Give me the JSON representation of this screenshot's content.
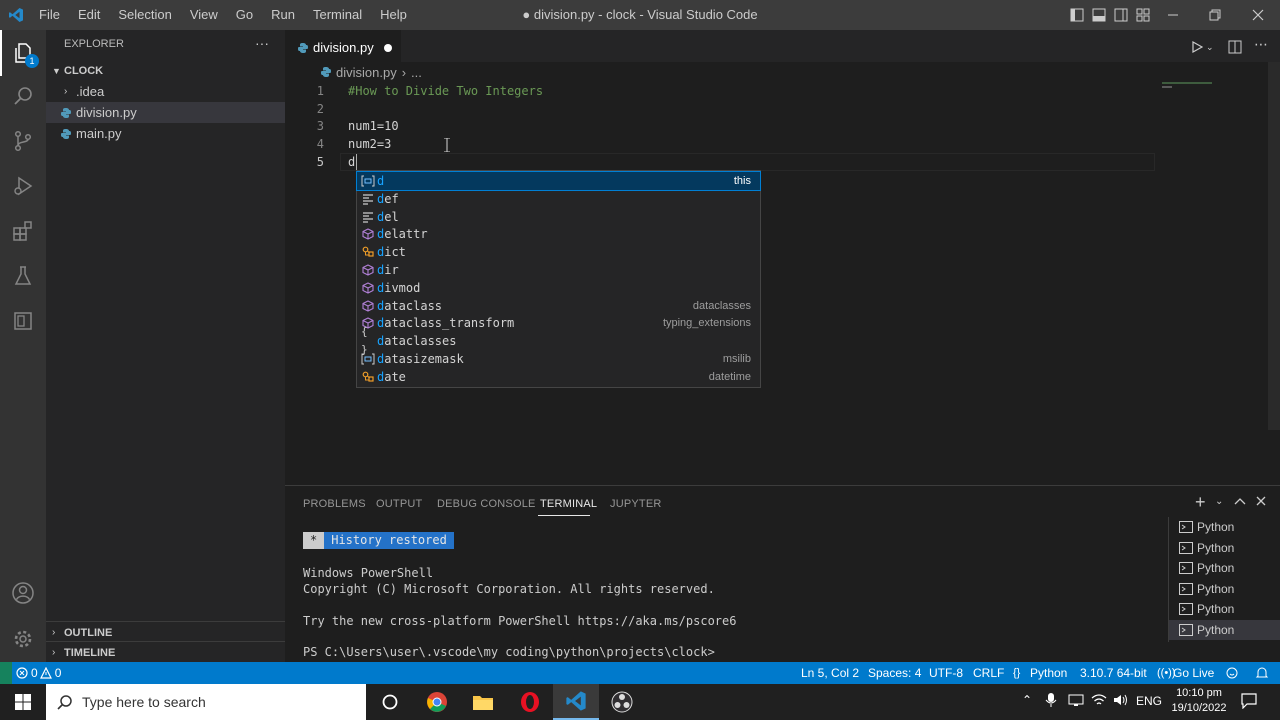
{
  "titlebar": {
    "menu": [
      "File",
      "Edit",
      "Selection",
      "View",
      "Go",
      "Run",
      "Terminal",
      "Help"
    ],
    "window_title": "● division.py - clock - Visual Studio Code"
  },
  "activity": {
    "explorer_badge": "1"
  },
  "sidebar": {
    "header": "EXPLORER",
    "more": "···",
    "folder": "CLOCK",
    "items": [
      ".idea",
      "division.py",
      "main.py"
    ],
    "outline": "OUTLINE",
    "timeline": "TIMELINE"
  },
  "editor": {
    "tab_label": "division.py",
    "breadcrumb_file": "division.py",
    "breadcrumb_more": "...",
    "lines": [
      {
        "n": "1",
        "text": "#How to Divide Two Integers"
      },
      {
        "n": "2",
        "text": ""
      },
      {
        "n": "3",
        "text": "num1=10"
      },
      {
        "n": "4",
        "text": "num2=3"
      },
      {
        "n": "5",
        "text": "d"
      }
    ],
    "suggestions": [
      {
        "match": "d",
        "rest": "",
        "detail": "this",
        "icon": "variable-icon"
      },
      {
        "match": "d",
        "rest": "ef",
        "detail": "",
        "icon": "keyword-icon"
      },
      {
        "match": "d",
        "rest": "el",
        "detail": "",
        "icon": "keyword-icon"
      },
      {
        "match": "d",
        "rest": "elattr",
        "detail": "",
        "icon": "function-icon"
      },
      {
        "match": "d",
        "rest": "ict",
        "detail": "",
        "icon": "class-icon"
      },
      {
        "match": "d",
        "rest": "ir",
        "detail": "",
        "icon": "function-icon"
      },
      {
        "match": "d",
        "rest": "ivmod",
        "detail": "",
        "icon": "function-icon"
      },
      {
        "match": "d",
        "rest": "ataclass",
        "detail": "dataclasses",
        "icon": "function-icon"
      },
      {
        "match": "d",
        "rest": "ataclass_transform",
        "detail": "typing_extensions",
        "icon": "function-icon"
      },
      {
        "match": "d",
        "rest": "ataclasses",
        "detail": "",
        "icon": "module-icon"
      },
      {
        "match": "d",
        "rest": "atasizemask",
        "detail": "msilib",
        "icon": "variable-icon"
      },
      {
        "match": "d",
        "rest": "ate",
        "detail": "datetime",
        "icon": "class-icon"
      }
    ]
  },
  "panel": {
    "tabs": [
      "PROBLEMS",
      "OUTPUT",
      "DEBUG CONSOLE",
      "TERMINAL",
      "JUPYTER"
    ],
    "active_tab": "TERMINAL",
    "history_star": "*",
    "history": "History restored",
    "terminal_lines": [
      "Windows PowerShell",
      "Copyright (C) Microsoft Corporation. All rights reserved.",
      "",
      "Try the new cross-platform PowerShell https://aka.ms/pscore6",
      "",
      "PS C:\\Users\\user\\.vscode\\my coding\\python\\projects\\clock>"
    ],
    "terminals": [
      "Python",
      "Python",
      "Python",
      "Python",
      "Python",
      "Python"
    ]
  },
  "status": {
    "errors": "0",
    "warnings": "0",
    "position": "Ln 5, Col 2",
    "spaces": "Spaces: 4",
    "encoding": "UTF-8",
    "eol": "CRLF",
    "language": "Python",
    "interpreter": "3.10.7 64-bit",
    "golive": "Go Live"
  },
  "taskbar": {
    "search_placeholder": "Type here to search",
    "lang": "ENG",
    "time": "10:10 pm",
    "date": "19/10/2022"
  },
  "colors": {
    "accent": "#007acc",
    "suggest_match": "#18a3ff",
    "function_icon": "#b180d7",
    "class_icon": "#ee9d28",
    "variable_icon": "#75beff"
  }
}
